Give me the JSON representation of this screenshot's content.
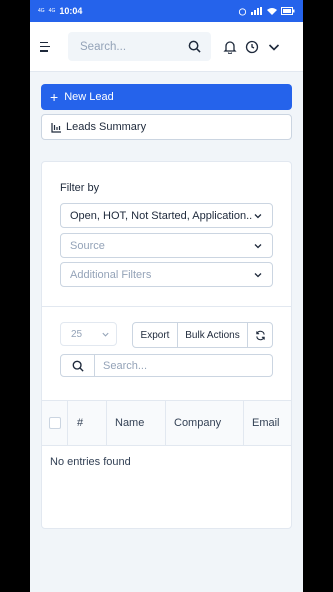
{
  "status": {
    "time": "10:04",
    "net1": "4G",
    "net2": "4G"
  },
  "header": {
    "search_placeholder": "Search..."
  },
  "actions": {
    "new_lead": "New Lead",
    "leads_summary": "Leads Summary"
  },
  "filters": {
    "title": "Filter by",
    "status_value": "Open, HOT, Not Started, Application...",
    "source_placeholder": "Source",
    "additional_placeholder": "Additional Filters"
  },
  "table": {
    "per_page": "25",
    "export": "Export",
    "bulk_actions": "Bulk Actions",
    "search_placeholder": "Search...",
    "columns": [
      "#",
      "Name",
      "Company",
      "Email"
    ],
    "empty": "No entries found"
  },
  "colors": {
    "primary": "#2563eb",
    "background": "#f1f5f9"
  }
}
